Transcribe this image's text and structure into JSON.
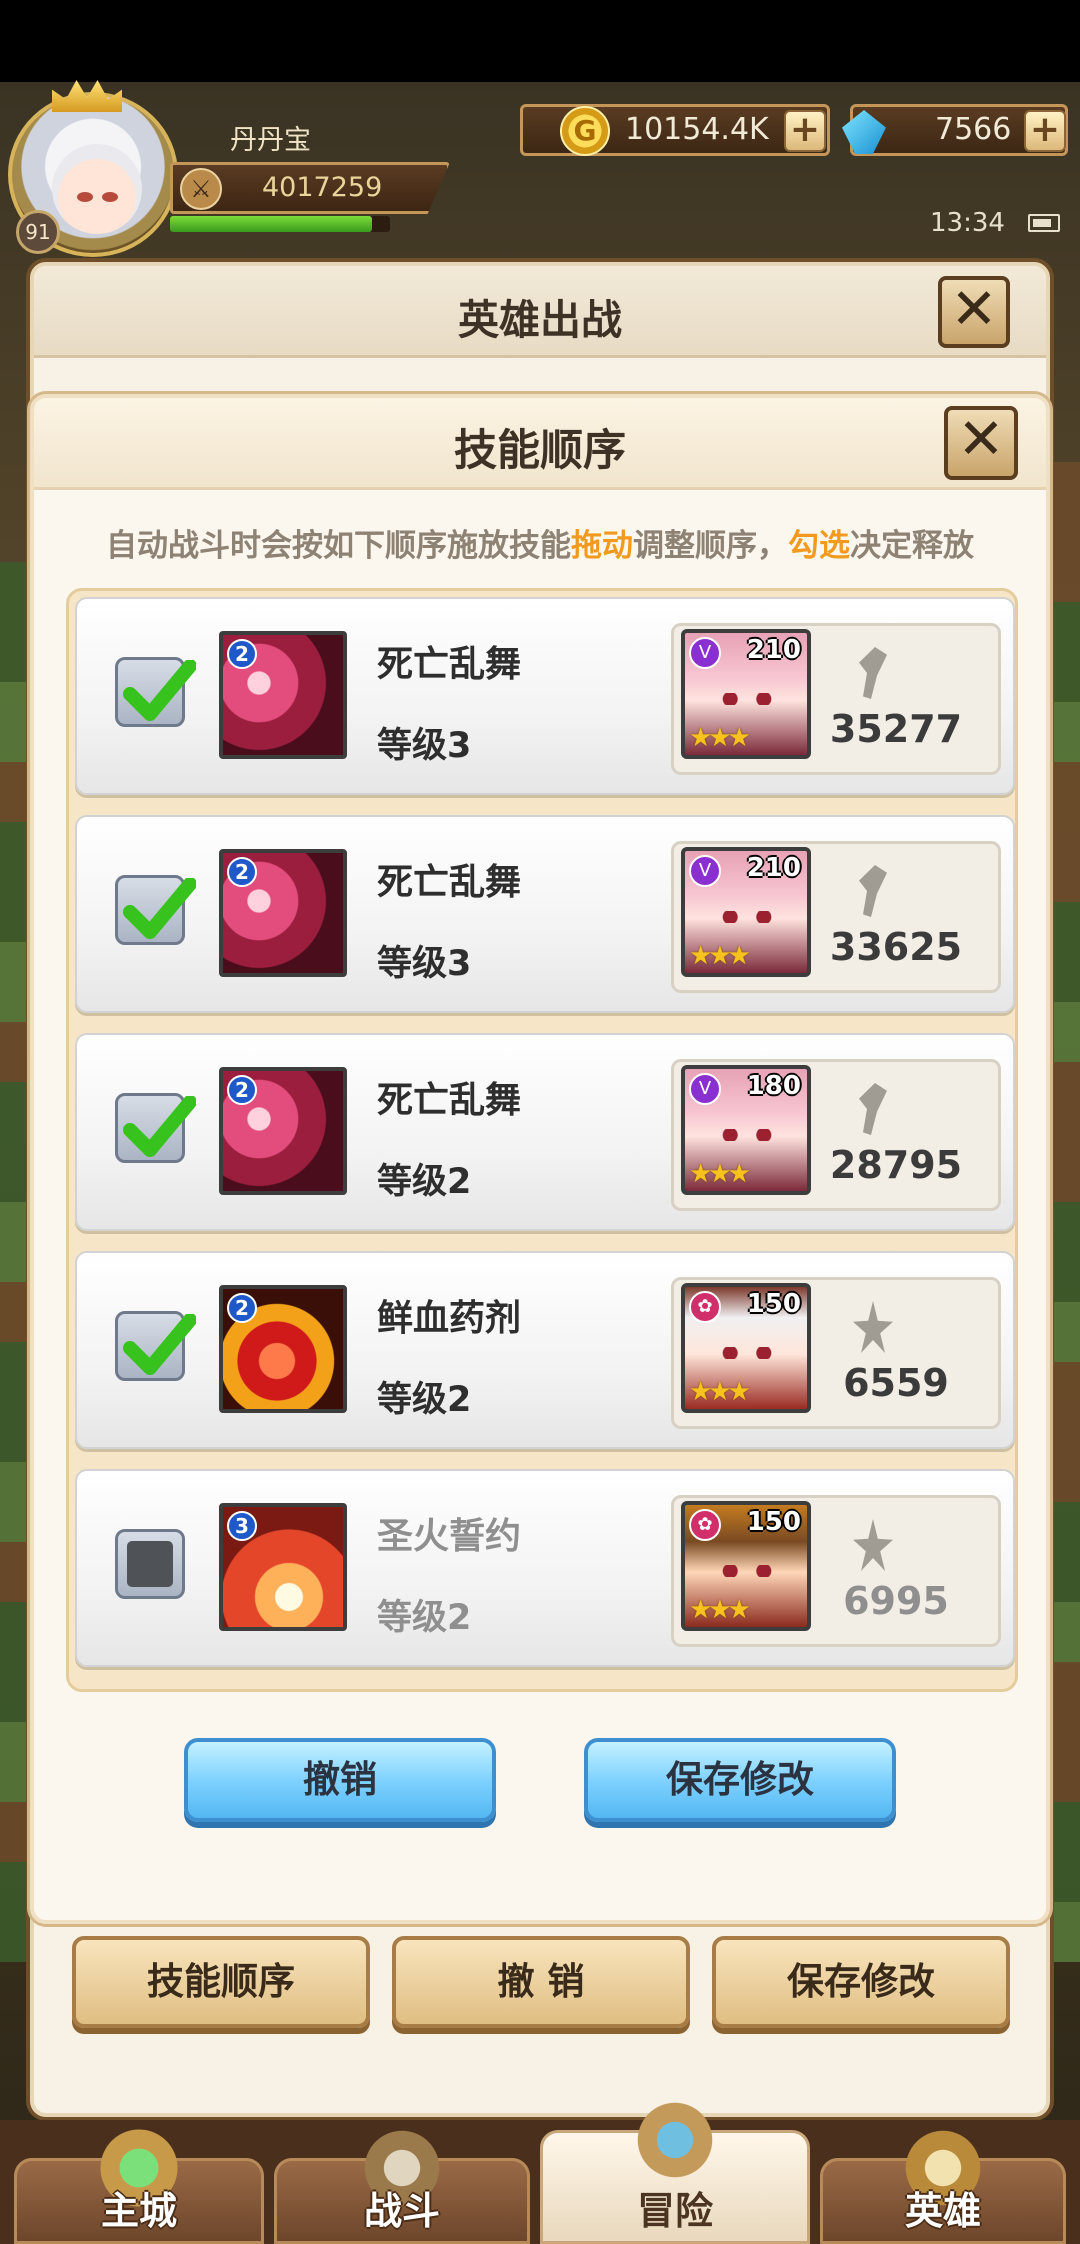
{
  "hud": {
    "player_name": "丹丹宝",
    "player_level": "91",
    "power": "4017259",
    "xp_fraction": 0.92,
    "gold": "10154.4K",
    "gems": "7566",
    "time": "13:34"
  },
  "outer_dialog": {
    "title": "英雄出战",
    "close": "✕",
    "buttons": {
      "skill_order": "技能顺序",
      "undo": "撤 销",
      "save": "保存修改"
    }
  },
  "skill_dialog": {
    "title": "技能顺序",
    "close": "✕",
    "hint_pre": "自动战斗时会按如下顺序施放技能",
    "hint_drag": "拖动",
    "hint_mid": "调整顺序，",
    "hint_check": "勾选",
    "hint_post": "决定释放",
    "rows": [
      {
        "checked": true,
        "skill_name": "死亡乱舞",
        "skill_badge": "2",
        "skill_level": "等级3",
        "hero_level": "210",
        "hero_stars": "★★★",
        "power": "35277"
      },
      {
        "checked": true,
        "skill_name": "死亡乱舞",
        "skill_badge": "2",
        "skill_level": "等级3",
        "hero_level": "210",
        "hero_stars": "★★★",
        "power": "33625"
      },
      {
        "checked": true,
        "skill_name": "死亡乱舞",
        "skill_badge": "2",
        "skill_level": "等级2",
        "hero_level": "180",
        "hero_stars": "★★★",
        "power": "28795"
      },
      {
        "checked": true,
        "skill_name": "鲜血药剂",
        "skill_badge": "2",
        "skill_level": "等级2",
        "hero_level": "150",
        "hero_stars": "★★★",
        "power": "6559"
      },
      {
        "checked": false,
        "skill_name": "圣火誓约",
        "skill_badge": "3",
        "skill_level": "等级2",
        "hero_level": "150",
        "hero_stars": "★★★",
        "power": "6995"
      }
    ],
    "undo": "撤销",
    "save": "保存修改"
  },
  "nav": {
    "main_city": "主城",
    "battle": "战斗",
    "adventure": "冒险",
    "hero": "英雄"
  },
  "colors": {
    "highlight": "#f29a1f",
    "check": "#37c21e"
  }
}
